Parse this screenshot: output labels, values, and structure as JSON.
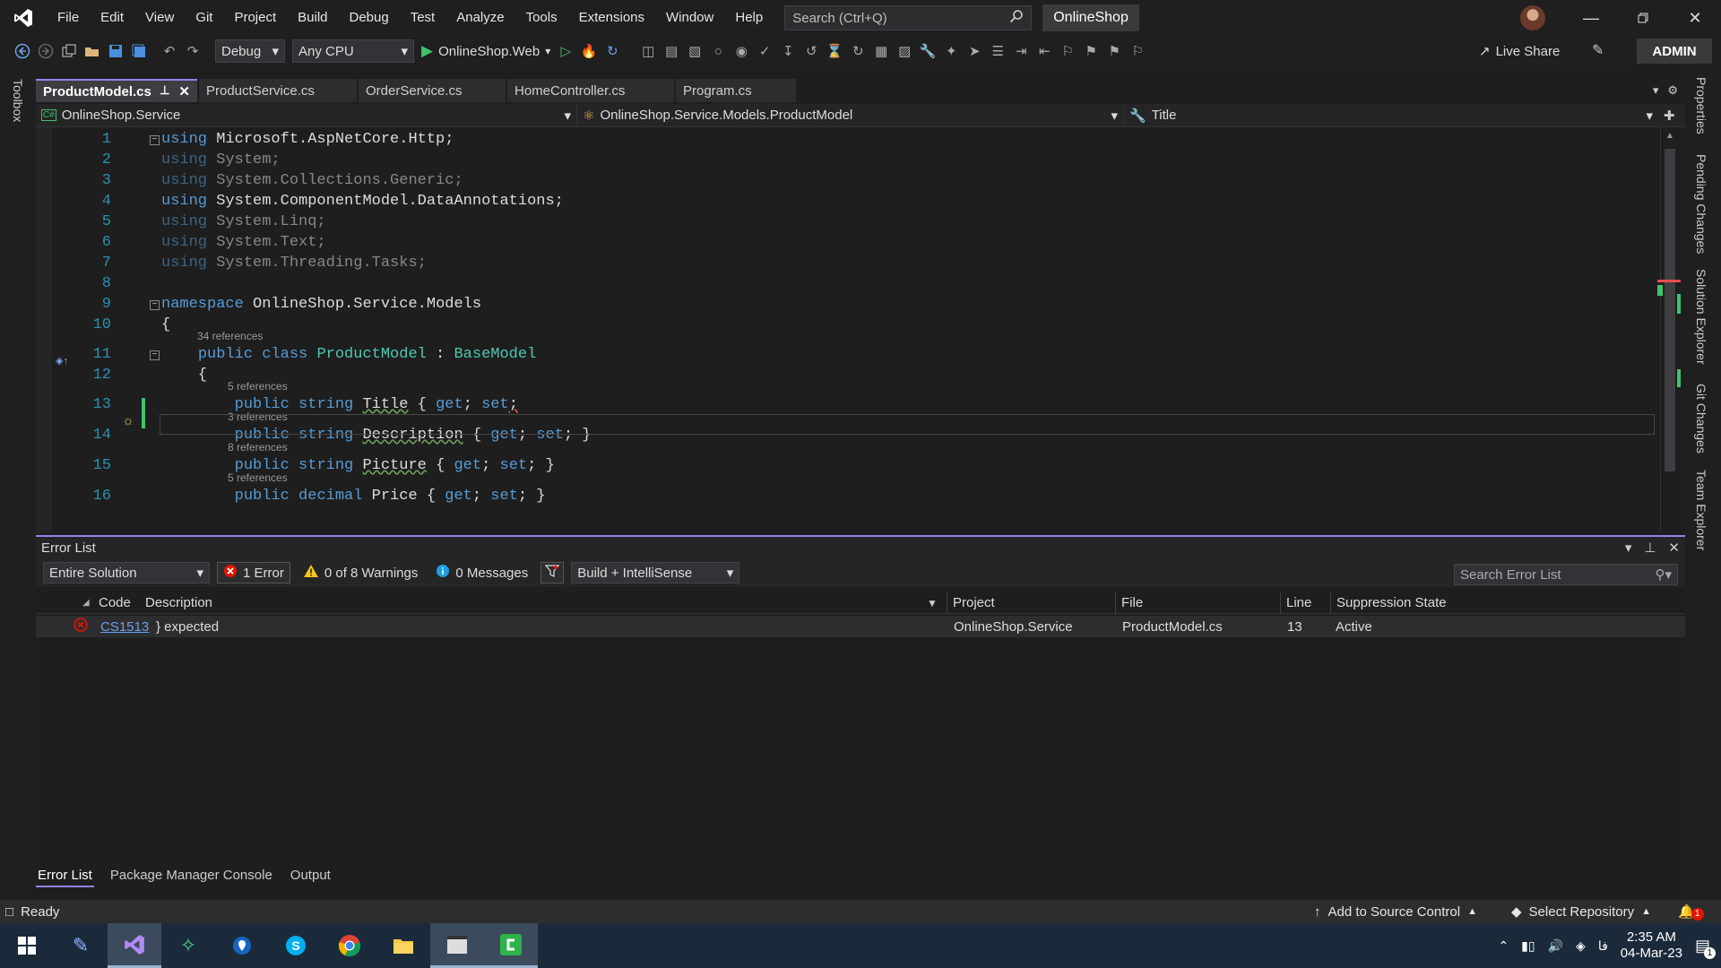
{
  "titlebar": {
    "menus": [
      "File",
      "Edit",
      "View",
      "Git",
      "Project",
      "Build",
      "Debug",
      "Test",
      "Analyze",
      "Tools",
      "Extensions",
      "Window",
      "Help"
    ],
    "search_placeholder": "Search (Ctrl+Q)",
    "solution_name": "OnlineShop"
  },
  "toolbar": {
    "config": "Debug",
    "platform": "Any CPU",
    "startup_project": "OnlineShop.Web",
    "live_share": "Live Share",
    "admin": "ADMIN"
  },
  "side_panels": {
    "left": [
      "Toolbox"
    ],
    "right": [
      "Properties",
      "Pending Changes",
      "Solution Explorer",
      "Git Changes",
      "Team Explorer"
    ]
  },
  "tabs": [
    {
      "label": "ProductModel.cs",
      "active": true
    },
    {
      "label": "ProductService.cs",
      "active": false
    },
    {
      "label": "OrderService.cs",
      "active": false
    },
    {
      "label": "HomeController.cs",
      "active": false
    },
    {
      "label": "Program.cs",
      "active": false
    }
  ],
  "navbar": {
    "project": "OnlineShop.Service",
    "type": "OnlineShop.Service.Models.ProductModel",
    "member": "Title"
  },
  "editor": {
    "lines": [
      {
        "n": "1",
        "parts": [
          [
            "kw",
            "using"
          ],
          [
            "id",
            " Microsoft.AspNetCore.Http;"
          ]
        ]
      },
      {
        "n": "2",
        "parts": [
          [
            "kw dim",
            "using"
          ],
          [
            "id dim",
            " System;"
          ]
        ]
      },
      {
        "n": "3",
        "parts": [
          [
            "kw dim",
            "using"
          ],
          [
            "id dim",
            " System.Collections.Generic;"
          ]
        ]
      },
      {
        "n": "4",
        "parts": [
          [
            "kw",
            "using"
          ],
          [
            "id",
            " System.ComponentModel.DataAnnotations;"
          ]
        ]
      },
      {
        "n": "5",
        "parts": [
          [
            "kw dim",
            "using"
          ],
          [
            "id dim",
            " System.Linq;"
          ]
        ]
      },
      {
        "n": "6",
        "parts": [
          [
            "kw dim",
            "using"
          ],
          [
            "id dim",
            " System.Text;"
          ]
        ]
      },
      {
        "n": "7",
        "parts": [
          [
            "kw dim",
            "using"
          ],
          [
            "id dim",
            " System.Threading.Tasks;"
          ]
        ]
      },
      {
        "n": "8",
        "parts": []
      },
      {
        "n": "9",
        "parts": [
          [
            "kw",
            "namespace"
          ],
          [
            "id",
            " OnlineShop.Service.Models"
          ]
        ]
      },
      {
        "n": "10",
        "parts": [
          [
            "id",
            "{"
          ]
        ]
      },
      {
        "n": "11",
        "lens": "34 references",
        "parts": [
          [
            "id",
            "    "
          ],
          [
            "kw",
            "public class "
          ],
          [
            "ty",
            "ProductModel"
          ],
          [
            "id",
            " : "
          ],
          [
            "ty",
            "BaseModel"
          ]
        ]
      },
      {
        "n": "12",
        "parts": [
          [
            "id",
            "    {"
          ]
        ]
      },
      {
        "n": "13",
        "lens": "5 references",
        "parts": [
          [
            "id",
            "        "
          ],
          [
            "kw",
            "public string "
          ],
          [
            "id squiggle",
            "Title"
          ],
          [
            "id",
            " { "
          ],
          [
            "kw",
            "get"
          ],
          [
            "id",
            "; "
          ],
          [
            "kw",
            "set"
          ],
          [
            "id errsq",
            ";"
          ]
        ]
      },
      {
        "n": "14",
        "lens": "3 references",
        "parts": [
          [
            "id",
            "        "
          ],
          [
            "kw",
            "public string "
          ],
          [
            "id squiggle",
            "Description"
          ],
          [
            "id",
            " { "
          ],
          [
            "kw",
            "get"
          ],
          [
            "id",
            "; "
          ],
          [
            "kw",
            "set"
          ],
          [
            "id",
            "; }"
          ]
        ]
      },
      {
        "n": "15",
        "lens": "8 references",
        "parts": [
          [
            "id",
            "        "
          ],
          [
            "kw",
            "public string "
          ],
          [
            "id squiggle",
            "Picture"
          ],
          [
            "id",
            " { "
          ],
          [
            "kw",
            "get"
          ],
          [
            "id",
            "; "
          ],
          [
            "kw",
            "set"
          ],
          [
            "id",
            "; }"
          ]
        ]
      },
      {
        "n": "16",
        "lens": "5 references",
        "parts": [
          [
            "id",
            "        "
          ],
          [
            "kw",
            "public decimal "
          ],
          [
            "id",
            "Price { "
          ],
          [
            "kw",
            "get"
          ],
          [
            "id",
            "; "
          ],
          [
            "kw",
            "set"
          ],
          [
            "id",
            "; }"
          ]
        ]
      }
    ]
  },
  "error_list": {
    "title": "Error List",
    "scope": "Entire Solution",
    "errors": "1 Error",
    "warnings": "0 of 8 Warnings",
    "messages": "0 Messages",
    "source": "Build + IntelliSense",
    "search_placeholder": "Search Error List",
    "columns": {
      "code": "Code",
      "description": "Description",
      "project": "Project",
      "file": "File",
      "line": "Line",
      "suppression": "Suppression State"
    },
    "rows": [
      {
        "code": "CS1513",
        "description": "} expected",
        "project": "OnlineShop.Service",
        "file": "ProductModel.cs",
        "line": "13",
        "suppression": "Active"
      }
    ]
  },
  "bottom_tabs": [
    "Error List",
    "Package Manager Console",
    "Output"
  ],
  "statusbar": {
    "state": "Ready",
    "source_control": "Add to Source Control",
    "repository": "Select Repository",
    "notifications": "1"
  },
  "taskbar": {
    "time": "2:35 AM",
    "date": "04-Mar-23",
    "lang": "فا",
    "notif_count": "1"
  }
}
